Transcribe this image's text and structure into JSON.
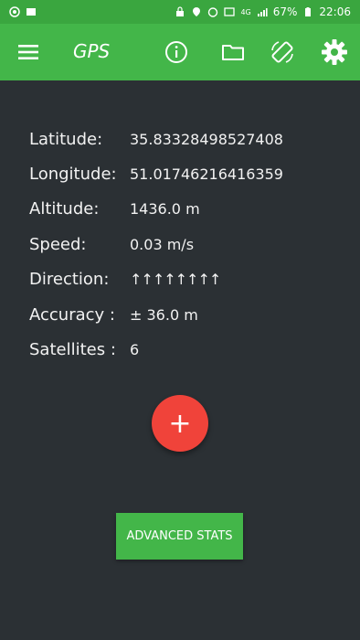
{
  "status_bar": {
    "battery": "67%",
    "time": "22:06",
    "network": "4G"
  },
  "app_bar": {
    "title": "GPS",
    "icons": [
      "menu-icon",
      "info-icon",
      "folder-icon",
      "screen-rotation-icon",
      "settings-icon"
    ]
  },
  "info": {
    "latitude_label": "Latitude:",
    "latitude_value": "35.83328498527408",
    "longitude_label": "Longitude:",
    "longitude_value": "51.01746216416359",
    "altitude_label": "Altitude:",
    "altitude_value": "1436.0 m",
    "speed_label": "Speed:",
    "speed_value": "0.03 m/s",
    "direction_label": "Direction:",
    "direction_value": "↑↑↑↑↑↑↑↑",
    "accuracy_label": "Accuracy :",
    "accuracy_value": "± 36.0 m",
    "satellites_label": "Satellites :",
    "satellites_value": "6"
  },
  "fab": {
    "label": "+"
  },
  "advanced_button": {
    "label": "ADVANCED STATS"
  },
  "colors": {
    "primary": "#43b649",
    "status": "#3aa63f",
    "background": "#2b3034",
    "fab": "#f0433a"
  }
}
